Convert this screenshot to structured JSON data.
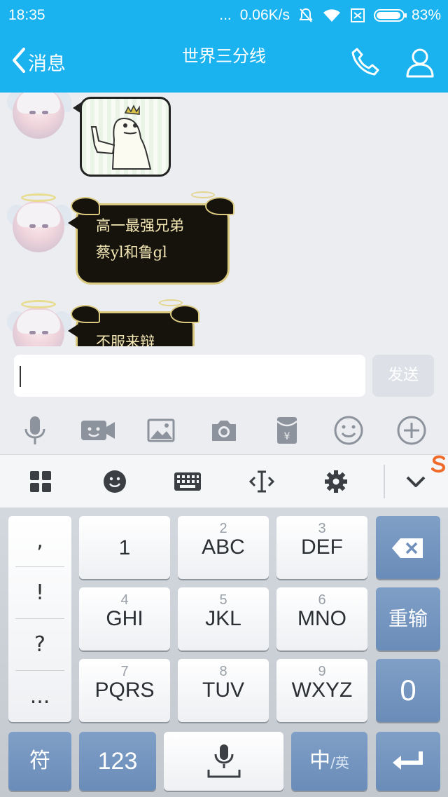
{
  "status_bar": {
    "time": "18:35",
    "dots": "...",
    "speed": "0.06K/s",
    "battery": "83%"
  },
  "header": {
    "back_label": "消息",
    "title": "世界三分线"
  },
  "messages": [
    {
      "type": "sticker"
    },
    {
      "type": "text",
      "lines": [
        "高一最强兄弟",
        "蔡yl和鲁gl"
      ]
    },
    {
      "type": "text",
      "lines": [
        "不服来辩"
      ]
    }
  ],
  "composer": {
    "input_value": "",
    "send_label": "发送"
  },
  "keyboard": {
    "punct": [
      ",",
      "!",
      "?",
      "..."
    ],
    "keys": [
      {
        "num": "",
        "label": "1"
      },
      {
        "num": "2",
        "label": "ABC"
      },
      {
        "num": "3",
        "label": "DEF"
      },
      {
        "num": "4",
        "label": "GHI"
      },
      {
        "num": "5",
        "label": "JKL"
      },
      {
        "num": "6",
        "label": "MNO"
      },
      {
        "num": "7",
        "label": "PQRS"
      },
      {
        "num": "8",
        "label": "TUV"
      },
      {
        "num": "9",
        "label": "WXYZ"
      }
    ],
    "retype_label": "重输",
    "zero_label": "0",
    "symbol_label": "符",
    "numbers_label": "123",
    "lang_main": "中",
    "lang_sub": "/英"
  },
  "colors": {
    "header": "#1bb3ef",
    "bubble_bg": "#16120c",
    "bubble_border": "#d9c981",
    "key_blue": "#6f90bc"
  }
}
